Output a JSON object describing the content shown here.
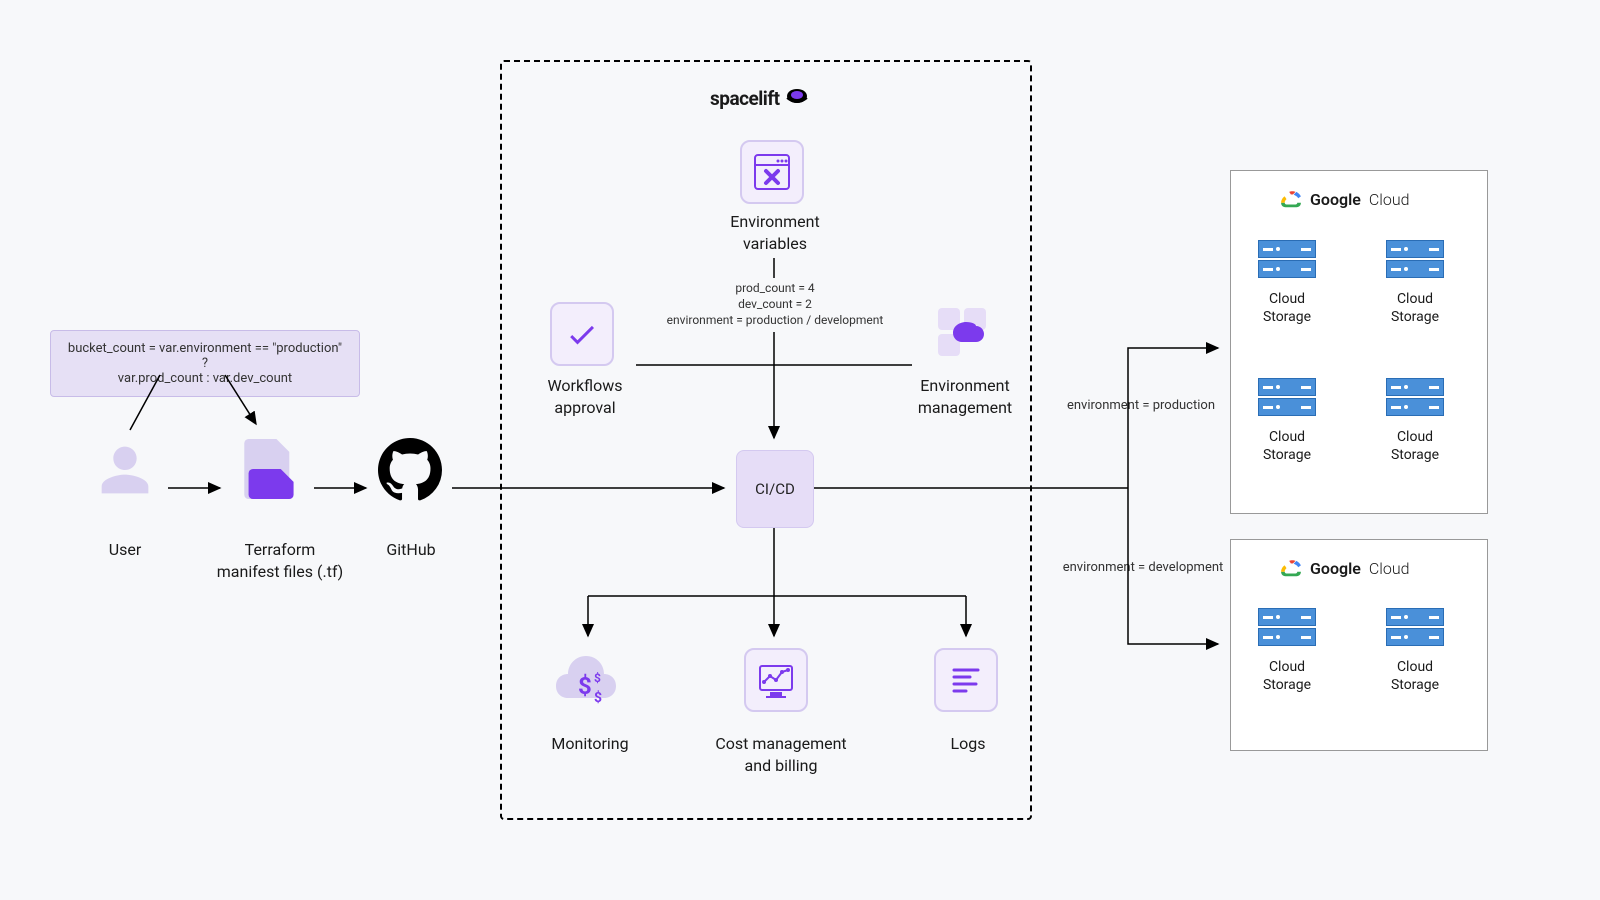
{
  "left": {
    "code_box_line1": "bucket_count = var.environment == \"production\" ?",
    "code_box_line2": "var.prod_count : var.dev_count",
    "user": "User",
    "terraform_l1": "Terraform",
    "terraform_l2": "manifest files (.tf)",
    "github": "GitHub"
  },
  "spacelift": {
    "brand": "spacelift",
    "env_vars_l1": "Environment",
    "env_vars_l2": "variables",
    "vars_detail_l1": "prod_count = 4",
    "vars_detail_l2": "dev_count = 2",
    "vars_detail_l3": "environment = production / development",
    "workflows_l1": "Workflows",
    "workflows_l2": "approval",
    "env_mgmt_l1": "Environment",
    "env_mgmt_l2": "management",
    "cicd": "CI/CD",
    "monitoring": "Monitoring",
    "cost_l1": "Cost management",
    "cost_l2": "and billing",
    "logs": "Logs"
  },
  "right": {
    "env_prod": "environment = production",
    "env_dev": "environment = development",
    "gcloud_brand_bold": "Google",
    "gcloud_brand_light": "Cloud",
    "storage_l1": "Cloud",
    "storage_l2": "Storage"
  }
}
